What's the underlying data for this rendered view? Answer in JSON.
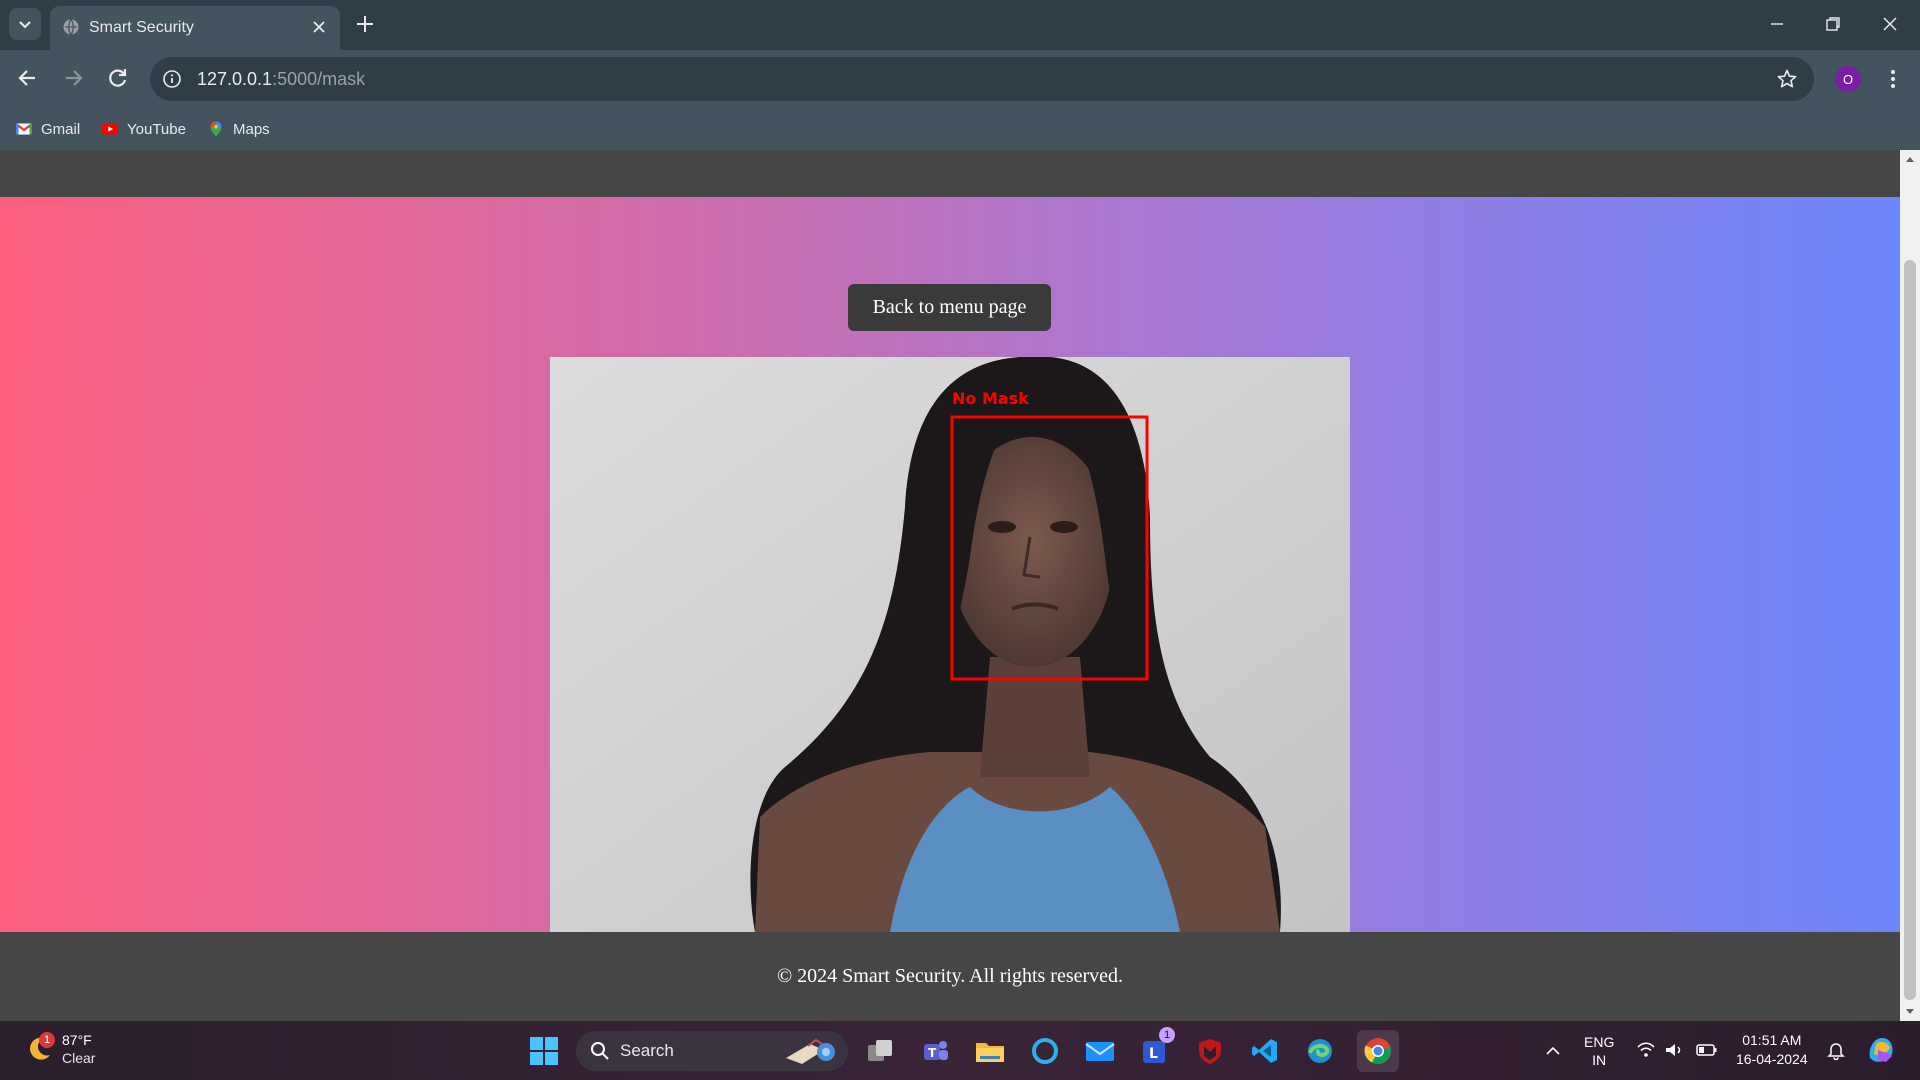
{
  "browser": {
    "tab_title": "Smart Security",
    "url_host": "127.0.0.1",
    "url_rest": ":5000/mask",
    "profile_initial": "O",
    "bookmarks": [
      {
        "label": "Gmail",
        "icon": "gmail-icon"
      },
      {
        "label": "YouTube",
        "icon": "youtube-icon"
      },
      {
        "label": "Maps",
        "icon": "maps-icon"
      }
    ]
  },
  "page": {
    "back_button_label": "Back to menu page",
    "detection_label": "No Mask",
    "footer_text": "© 2024 Smart Security. All rights reserved.",
    "colors": {
      "header_bg": "#464646",
      "gradient_start": "#fd5f7f",
      "gradient_end": "#6d86fb",
      "detection_box": "#ff0000"
    }
  },
  "taskbar": {
    "weather_temp": "87°F",
    "weather_desc": "Clear",
    "weather_badge": "1",
    "search_label": "Search",
    "lens_badge": "1",
    "lang_top": "ENG",
    "lang_bottom": "IN",
    "time": "01:51 AM",
    "date": "16-04-2024"
  }
}
